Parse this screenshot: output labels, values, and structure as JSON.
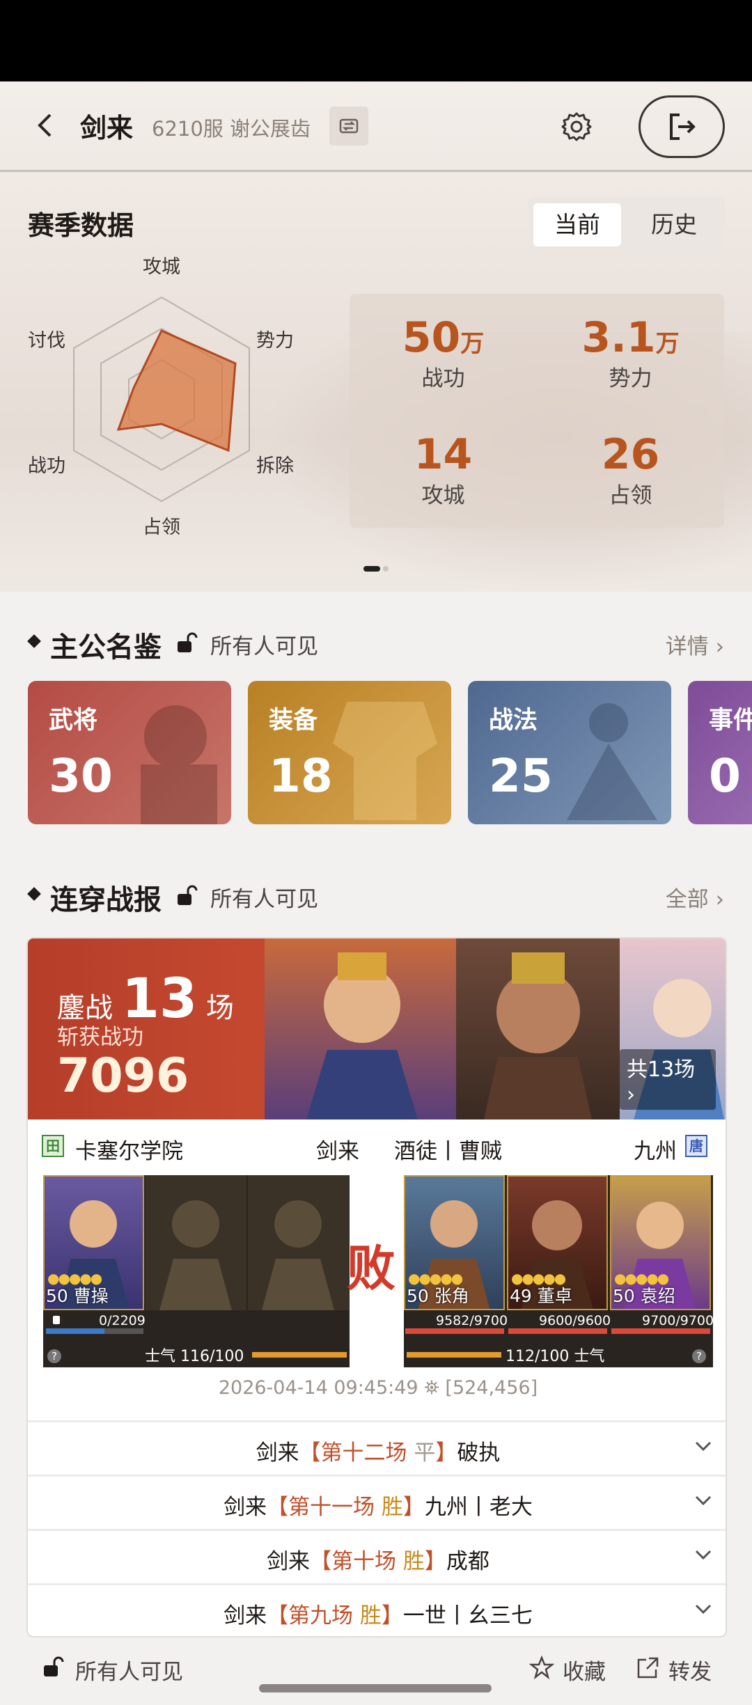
{
  "header": {
    "title": "剑来",
    "server": "6210服 谢公展齿"
  },
  "season": {
    "title": "赛季数据",
    "tabs": [
      "当前",
      "历史"
    ],
    "radar_labels": [
      "攻城",
      "势力",
      "拆除",
      "占领",
      "战功",
      "讨伐"
    ],
    "stats": [
      {
        "value": "50",
        "unit": "万",
        "label": "战功"
      },
      {
        "value": "3.1",
        "unit": "万",
        "label": "势力"
      },
      {
        "value": "14",
        "unit": "",
        "label": "攻城"
      },
      {
        "value": "26",
        "unit": "",
        "label": "占领"
      }
    ]
  },
  "codex": {
    "title": "主公名鉴",
    "visibility": "所有人可见",
    "more": "详情",
    "cards": [
      {
        "label": "武将",
        "value": "30",
        "color": "#b9514a"
      },
      {
        "label": "装备",
        "value": "18",
        "color": "#c58a2e"
      },
      {
        "label": "战法",
        "value": "25",
        "color": "#5a7398"
      },
      {
        "label": "事件",
        "value": "0",
        "color": "#8b5aa3"
      }
    ]
  },
  "battles": {
    "title": "连穿战报",
    "visibility": "所有人可见",
    "more": "全部",
    "banner": {
      "prefix": "鏖战",
      "count": "13",
      "suffix": "场",
      "sub": "斩获战功",
      "merit": "7096",
      "total": "共13场"
    },
    "left_team": {
      "flag": "田",
      "alliance": "卡塞尔学院",
      "player": "剑来"
    },
    "right_team": {
      "flag": "唐",
      "player": "酒徒丨曹贼",
      "alliance": "九州"
    },
    "result": "败",
    "left_generals": [
      {
        "level": "50",
        "name": "曹操"
      }
    ],
    "right_generals": [
      {
        "level": "50",
        "name": "张角",
        "hp": "9582/9700"
      },
      {
        "level": "49",
        "name": "董卓",
        "hp": "9600/9600"
      },
      {
        "level": "50",
        "name": "袁绍",
        "hp": "9700/9700"
      }
    ],
    "left_hp": "0/2209",
    "left_morale": "士气 116/100",
    "right_morale": "112/100 士气",
    "meta": "2026-04-14 09:45:49",
    "coords": "[524,456]",
    "rows": [
      {
        "player": "剑来",
        "lb": "【",
        "round": "第十二场",
        "result": "平",
        "rb": "】",
        "opponent": "破执"
      },
      {
        "player": "剑来",
        "lb": "【",
        "round": "第十一场",
        "result": "胜",
        "rb": "】",
        "opponent": "九州丨老大"
      },
      {
        "player": "剑来",
        "lb": "【",
        "round": "第十场",
        "result": "胜",
        "rb": "】",
        "opponent": "成都"
      },
      {
        "player": "剑来",
        "lb": "【",
        "round": "第九场",
        "result": "胜",
        "rb": "】",
        "opponent": "一世丨幺三七"
      }
    ]
  },
  "footer": {
    "visibility": "所有人可见",
    "favorite": "收藏",
    "share": "转发"
  }
}
